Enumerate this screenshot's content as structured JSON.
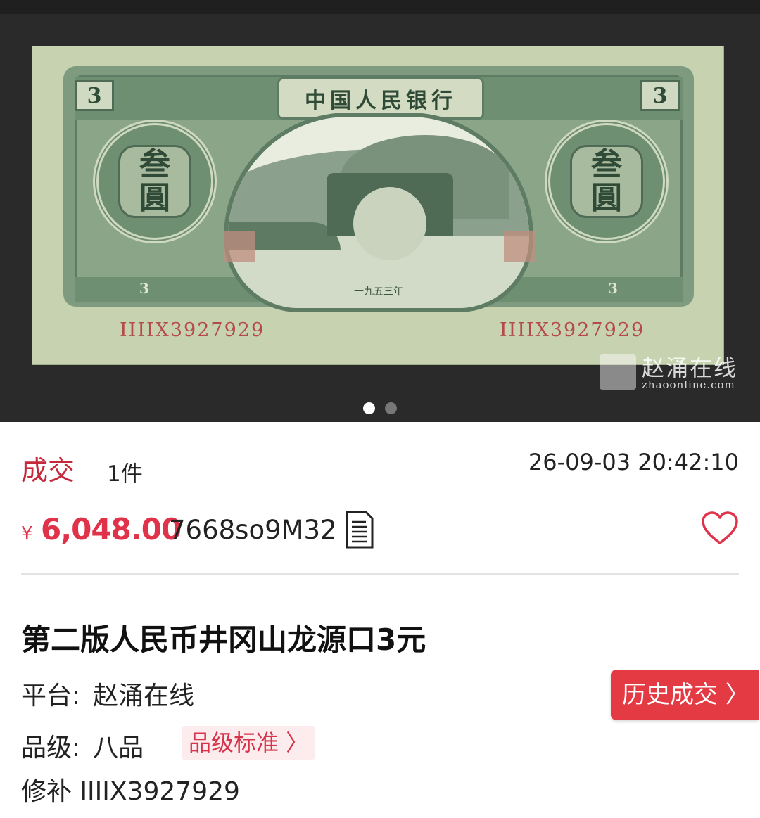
{
  "banknote": {
    "bank_name": "中国人民银行",
    "denomination_numeral": "3",
    "denomination_chars": [
      "叁",
      "圓"
    ],
    "year_text": "一九五三年",
    "serial_left": "IIIIX3927929",
    "serial_right": "IIIIX3927929"
  },
  "watermark": {
    "cn": "赵涌在线",
    "en": "zhaoonline.com"
  },
  "carousel": {
    "total": 2,
    "active_index": 0
  },
  "deal": {
    "label": "成交",
    "count": "1件",
    "time": "26-09-03 20:42:10"
  },
  "price": {
    "symbol": "¥",
    "value": "6,048.00",
    "code": "7668so9M32",
    "icon": "document-icon"
  },
  "favorite": {
    "icon": "heart-icon"
  },
  "item": {
    "title": "第二版人民币井冈山龙源口3元",
    "platform_label": "平台:",
    "platform_value": "赵涌在线",
    "grade_label": "品级:",
    "grade_value": "八品",
    "grade_standard": "品级标准 〉",
    "repair_text": "修补 IIIIX3927929"
  },
  "history_button": "历史成交 〉",
  "colors": {
    "accent_red": "#e0334a",
    "button_red": "#e33a44",
    "note_green": "#6f8f73"
  }
}
